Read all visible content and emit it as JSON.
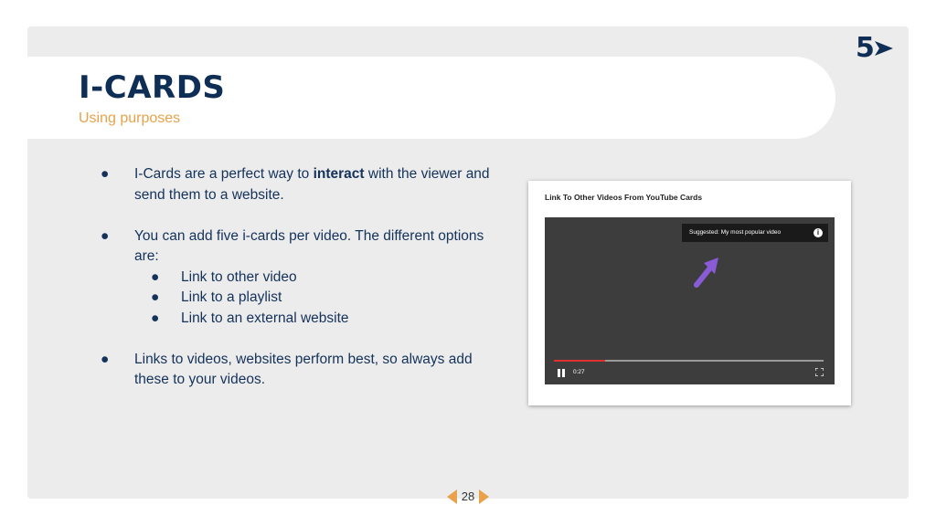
{
  "slide": {
    "title": "I-CARDS",
    "subtitle": "Using purposes",
    "logo_text": "5",
    "bullets": [
      {
        "before": "I-Cards are a perfect way to ",
        "bold": "interact",
        "after": " with the viewer and send them to a website."
      },
      {
        "text": "You can add five i-cards per video. The different options are:"
      },
      {
        "text": "Links to videos, websites perform best, so always add these to your videos."
      }
    ],
    "sub_bullets": [
      "Link to other video",
      "Link to a playlist",
      "Link to an external website"
    ],
    "bullet_symbol": "●",
    "page_number": "28"
  },
  "card": {
    "title": "Link To Other Videos From YouTube Cards",
    "tooltip": "Suggested: My most popular video",
    "info_icon": "i",
    "time": "0:27",
    "progress_fraction": 0.19
  },
  "colors": {
    "title": "#0f2e55",
    "subtitle": "#e8a24b",
    "accent_orange": "#e8a24b",
    "pointer_arrow": "#8a5bd6",
    "progress_red": "#e03030"
  }
}
